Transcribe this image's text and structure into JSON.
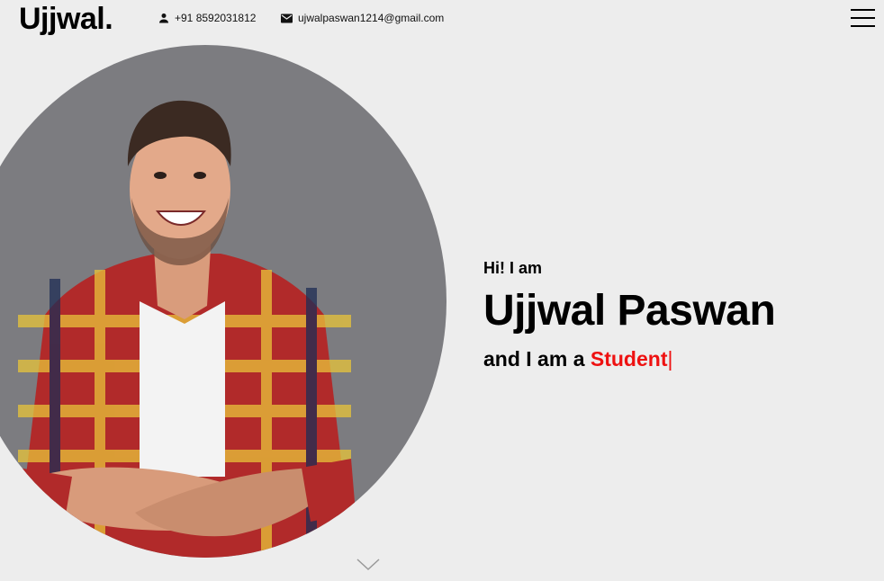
{
  "header": {
    "logo": "Ujjwal.",
    "phone": "+91 8592031812",
    "email": "ujwalpaswan1214@gmail.com",
    "icons": {
      "phone": "person-icon",
      "email": "mail-icon",
      "menu": "hamburger-menu-icon"
    }
  },
  "hero": {
    "greeting": "Hi! I am",
    "name": "Ujjwal Paswan",
    "role_prefix": "and I am a ",
    "role_highlight": "Student",
    "cursor": "|",
    "accent_color": "#ee1111",
    "scroll_icon": "chevron-down-icon"
  }
}
